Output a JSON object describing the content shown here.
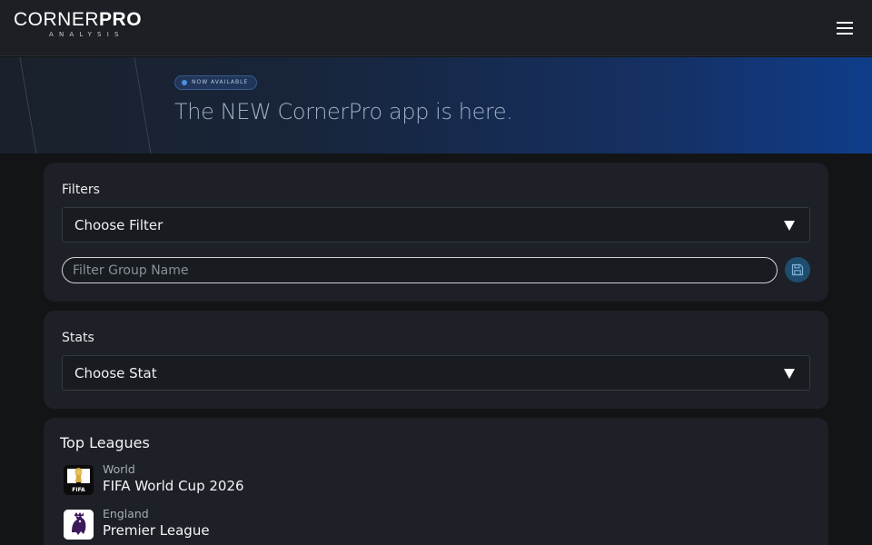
{
  "header": {
    "logo_light": "CORNER",
    "logo_bold": "PRO",
    "logo_sub": "ANALYSIS",
    "menu_icon": "hamburger-menu-icon"
  },
  "banner": {
    "badge": "NOW AVAILABLE",
    "title": "The NEW CornerPro app is here."
  },
  "filters": {
    "label": "Filters",
    "select_value": "Choose Filter",
    "group_name_placeholder": "Filter Group Name",
    "save_icon": "save-icon"
  },
  "stats": {
    "label": "Stats",
    "select_value": "Choose Stat"
  },
  "top_leagues": {
    "title": "Top Leagues",
    "items": [
      {
        "country": "World",
        "name": "FIFA World Cup 2026",
        "icon": "fifa-world-cup-logo-icon"
      },
      {
        "country": "England",
        "name": "Premier League",
        "icon": "premier-league-logo-icon"
      }
    ]
  },
  "colors": {
    "background": "#121416",
    "card": "#1d2026",
    "banner_end": "#0f3d8a",
    "save_button": "#1f4d6e"
  }
}
